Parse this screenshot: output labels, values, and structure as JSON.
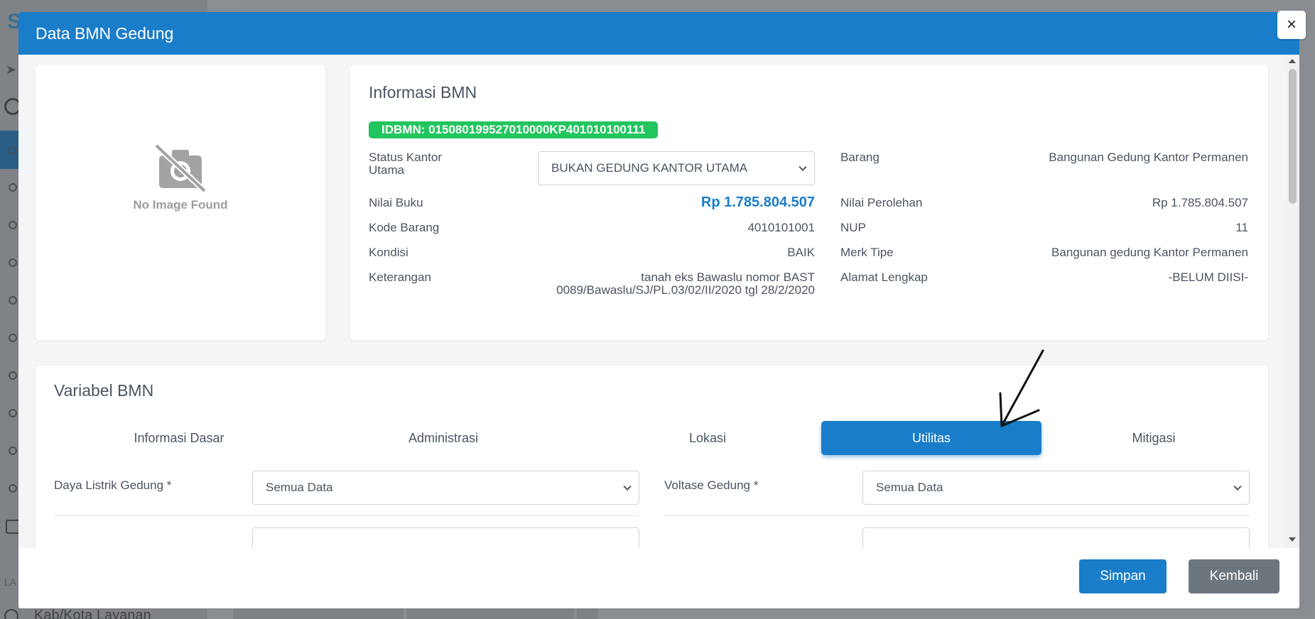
{
  "modal": {
    "title": "Data BMN Gedung",
    "close_symbol": "×"
  },
  "image_panel": {
    "placeholder_text": "No Image Found",
    "icon": "no-image-camera-icon"
  },
  "info": {
    "title": "Informasi BMN",
    "idbmn": "IDBMN: 015080199527010000KP401010100111",
    "left": {
      "status_label": "Status Kantor Utama",
      "status_value": "BUKAN GEDUNG KANTOR UTAMA",
      "nilai_buku_label": "Nilai Buku",
      "nilai_buku_value": "Rp 1.785.804.507",
      "kode_barang_label": "Kode Barang",
      "kode_barang_value": "4010101001",
      "kondisi_label": "Kondisi",
      "kondisi_value": "BAIK",
      "keterangan_label": "Keterangan",
      "keterangan_value": "tanah eks Bawaslu nomor BAST 0089/Bawaslu/SJ/PL.03/02/II/2020 tgl 28/2/2020"
    },
    "right": {
      "barang_label": "Barang",
      "barang_value": "Bangunan Gedung Kantor Permanen",
      "nilai_perolehan_label": "Nilai Perolehan",
      "nilai_perolehan_value": "Rp 1.785.804.507",
      "nup_label": "NUP",
      "nup_value": "11",
      "merk_label": "Merk Tipe",
      "merk_value": "Bangunan gedung Kantor Permanen",
      "alamat_label": "Alamat Lengkap",
      "alamat_value": "-BELUM DIISI-"
    }
  },
  "variabel": {
    "title": "Variabel BMN",
    "tabs": [
      {
        "label": "Informasi Dasar",
        "active": false
      },
      {
        "label": "Administrasi",
        "active": false
      },
      {
        "label": "Lokasi",
        "active": false
      },
      {
        "label": "Utilitas",
        "active": true
      },
      {
        "label": "Mitigasi",
        "active": false
      }
    ],
    "fields": {
      "daya_label": "Daya Listrik Gedung *",
      "daya_value": "Semua Data",
      "voltase_label": "Voltase Gedung *",
      "voltase_value": "Semua Data"
    }
  },
  "footer": {
    "save_label": "Simpan",
    "back_label": "Kembali"
  },
  "background": {
    "layanan_label": "LA",
    "kab_label": "Kab/Kota Layanan"
  },
  "colors": {
    "primary": "#1a7dc9",
    "success": "#22c55e",
    "secondary": "#6e767d"
  }
}
